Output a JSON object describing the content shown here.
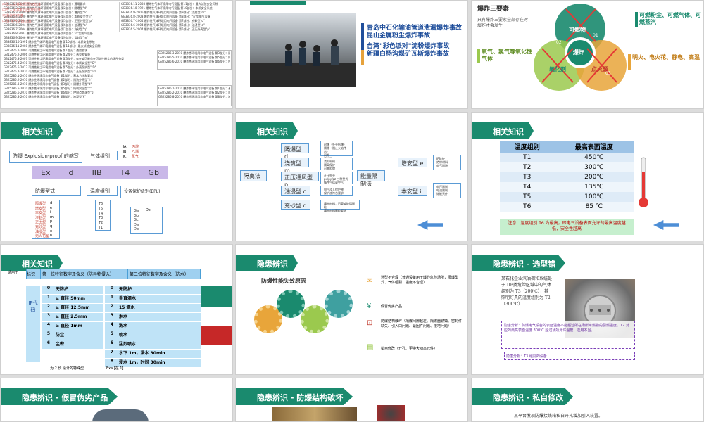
{
  "slides": {
    "s1": {
      "lines": [
        "GB3836.1-2000 爆炸性气体环境用电气设备 第1部分：通用要求",
        "GB3836.2-2000 爆炸性气体环境用电气设备 第2部分：隔爆型\"d\"",
        "GB3836.3-2000 爆炸性气体环境用电气设备 第3部分：增安型\"e\"",
        "GB3836.4-2000 爆炸性气体环境用电气设备 第4部分：本质安全型\"i\"",
        "GB3836.5-2004 爆炸性气体环境用电气设备 第5部分：正压外壳型\"p\"",
        "GB3836.6-2004 爆炸性气体环境用电气设备 第6部分：油浸型\"o\"",
        "GB3836.7-2004 爆炸性气体环境用电气设备 第7部分：充砂型\"q\"",
        "GB3836.8-2003 爆炸性气体环境用电气设备 第8部分：\"n\"型电气设备",
        "GB3836.9-2006 爆炸性气体环境用电气设备 第9部分：浇封型\"m\"",
        "GB3836.10-1991 爆炸性气体环境用电气设备 第10部分：本质安全系统",
        "GB3836.11-2008 爆炸性气体环境用电气设备 第11部分：最大试验安全间隙",
        "GB12476.1-2000 可燃性粉尘环境用电气设备 第1部分：通用要求",
        "GB12476.2-2006 可燃性粉尘环境用电气设备 第2部分：选型和安装",
        "GB12476.3-2007 可燃性粉尘环境用电气设备 第3部分：存在或可能存在可燃性粉尘的场所分类",
        "GB12476.4-2010 可燃性粉尘环境用电气设备 第4部分：本质安全型\"iD\"",
        "GB12476.5-2013 可燃性粉尘环境用电气设备 第5部分：外壳保护型\"tD\"",
        "GB12476.7-2010 可燃性粉尘环境用电气设备 第7部分：正压保护型\"pD\"",
        "GB25286.1-2010 爆炸性环境用非电气设备 第1部分：基本方法和要求",
        "GB25286.2-2010 爆炸性环境用非电气设备 第2部分：限流外壳型\"fr\"",
        "GB25286.3-2010 爆炸性环境用非电气设备 第3部分：隔爆外壳型\"d\"",
        "GB25286.5-2010 爆炸性环境用非电气设备 第5部分：结构安全型\"c\"",
        "GB25286.6-2010 爆炸性环境用非电气设备 第6部分：控制点燃源型\"b\"",
        "GB25286.8-2010 爆炸性环境用非电气设备 第8部分：液浸型\"k\""
      ],
      "red": [
        "中华人民共和国国家标准",
        "中华人民共和国国家标准",
        "可爆炸性环境",
        "中国·电气防爆标准"
      ]
    },
    "s2": {
      "items": [
        "青岛中石化输油管道泄漏爆炸事故",
        "昆山金属粉尘爆炸事故",
        "台湾\"彩色派对\"淀粉爆炸事故",
        "新疆白杨沟煤矿瓦斯爆炸事故"
      ]
    },
    "s3": {
      "title": "爆炸三要素",
      "desc": "只有爆炸三要素全部存在时爆炸才会发生",
      "center": "爆炸",
      "top": "可燃物",
      "left": "氧化剂",
      "right": "点火源",
      "n1": "01",
      "n2": "02",
      "n3": "03",
      "label_right_top": "可燃粉尘、可燃气体、可燃蒸汽",
      "label_left": "氧气、氯气等氧化性气体",
      "label_right_bottom": "明火、电火花、静电、高温"
    },
    "s4": {
      "tag": "相关知识",
      "title": "防爆 Explosion-proof 的缩写",
      "group": "气体组别",
      "codes": [
        "IIA",
        "IIB",
        "IIC"
      ],
      "gases": [
        "丙烷",
        "乙烯",
        "氢气"
      ],
      "marking": [
        "Ex",
        "d",
        "IIB",
        "T4",
        "Gb"
      ],
      "type_title": "防爆型式",
      "temp_title": "温度组别",
      "epl_title": "设备保护级别(EPL)",
      "types": [
        "隔爆型",
        "增安型",
        "本安型",
        "浇封型",
        "正压型",
        "充砂型",
        "油浸型",
        "无火花型"
      ],
      "type_codes": [
        "d",
        "e",
        "i",
        "m",
        "p",
        "q",
        "o",
        "n"
      ],
      "temps": [
        "T1",
        "T2",
        "T3",
        "T4",
        "T5",
        "T6"
      ],
      "epl1": [
        "Ga",
        "Gb",
        "Gc",
        "Da",
        "Db"
      ],
      "epl2": [
        "Dc"
      ]
    },
    "s5": {
      "tag": "相关知识",
      "left": "隔离法",
      "types": [
        "隔爆型 d",
        "浇筑型 m",
        "正压通风型 p",
        "油浸型 o",
        "充砂型 q"
      ],
      "notes": [
        "能量限制法",
        "增安型 e",
        "本安型 i"
      ],
      "d_notes": [
        "耐爆（外壳抗爆）",
        "隔爆（阻止火焰传出）",
        "间隙",
        "接合面"
      ],
      "m_notes": [
        "浇封材料",
        "隔离保护",
        "可靠阻燃"
      ],
      "p_notes": [
        "正压外壳",
        "px/py/pz 三种型式",
        "惰性气体或空气"
      ],
      "o_notes": [
        "电气浸入保护液",
        "保护液符合要求"
      ],
      "q_notes": [
        "填充材料：石英或玻璃颗粒",
        "填充材料颗粒要求"
      ],
      "e_notes": [
        "IP防护",
        "绝缘材料",
        "电气间隙"
      ],
      "i_notes": [
        "电压限制",
        "电流限制",
        "储能元件"
      ]
    },
    "s6": {
      "tag": "相关知识",
      "h1": "温度组别",
      "h2": "最高表面温度",
      "rows": [
        [
          "T1",
          "450℃"
        ],
        [
          "T2",
          "300℃"
        ],
        [
          "T3",
          "200℃"
        ],
        [
          "T4",
          "135℃"
        ],
        [
          "T5",
          "100℃"
        ],
        [
          "T6",
          "85 ℃"
        ]
      ],
      "note": "注意：温度组别 T6 为最高，即电气设备表面允许的最高温度越低，安全性越高"
    },
    "s7": {
      "tag": "相关知识",
      "side": "适用于",
      "col_code": "标识",
      "col1": "第一位特征数字及含义（防异物侵入）",
      "col2": "第二位特征数字及含义（防水）",
      "ip": "IP代码",
      "rows1": [
        [
          "0",
          "无防护"
        ],
        [
          "1",
          "≥ 直径 50mm"
        ],
        [
          "2",
          "≥ 直径 12.5mm"
        ],
        [
          "3",
          "≥ 直径 2.5mm"
        ],
        [
          "4",
          "≥ 直径 1mm"
        ],
        [
          "5",
          "防尘"
        ],
        [
          "6",
          "尘密"
        ]
      ],
      "rows2": [
        [
          "0",
          "无防护"
        ],
        [
          "1",
          "垂直滴水"
        ],
        [
          "2",
          "15 滴水"
        ],
        [
          "3",
          "淋水"
        ],
        [
          "4",
          "溅水"
        ],
        [
          "5",
          "喷水"
        ],
        [
          "6",
          "猛烈喷水"
        ],
        [
          "7",
          "水下 1m，浸水 30min"
        ],
        [
          "8",
          "浸水  1m，时间  30min"
        ]
      ],
      "foot1": "为 2 长 设计的特殊型",
      "foot2": "Exa [在 1]"
    },
    "s8": {
      "tag": "隐患辨识",
      "title": "防爆性能失效原因",
      "items": [
        "选型不合理（普通设备用于爆炸危险场所，隔爆型式、气体组别、温度不合理）",
        "假冒伪劣产品",
        "防爆结构破坏（隔爆间隙超差、隔爆面锈蚀、密封件缺失、引入口问题、紧固件问题、接地问题）",
        "私自修改（开孔、更换大功率元件）"
      ]
    },
    "s9": {
      "tag": "隐患辨识 - 选型错",
      "text": "某石化企业汽油调和系统处于 IIB类危险区域中的气体组别为 T3（200℃），其照明灯具的温度组别为 T2（300℃）",
      "analysis": "隐患分析：防爆电气设备的表面温度不能超过所在场所可燃物的引燃温度。T2 对应的最高表面温度 300℃ 超过场所允许温度，选用不当。",
      "extra": "隐患分析：T3 组别的设备"
    },
    "s10": {
      "tag": "隐患辨识 - 假冒伪劣产品"
    },
    "s11": {
      "tag": "隐患辨识 - 防爆结构破坏"
    },
    "s12": {
      "tag": "隐患辨识 - 私自修改",
      "text": "某平台发现防爆接线箱私自开孔增加引入装置。"
    }
  }
}
